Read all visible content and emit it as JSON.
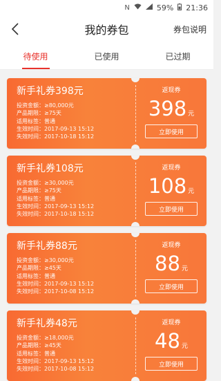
{
  "status_bar": {
    "battery": "59%",
    "time": "21:36"
  },
  "nav": {
    "title": "我的券包",
    "right_label": "券包说明"
  },
  "tabs": [
    {
      "label": "待使用",
      "active": true
    },
    {
      "label": "已使用",
      "active": false
    },
    {
      "label": "已过期",
      "active": false
    }
  ],
  "row_labels": {
    "amount": "投资金额：",
    "period": "产品期限：",
    "tag": "适用标签：",
    "start": "生效时间：",
    "end": "失效时间："
  },
  "coupons": [
    {
      "title": "新手礼券398元",
      "amount_req": "≥80,000元",
      "period": "≥75天",
      "tag": "普通",
      "start": "2017-09-13 15:12",
      "end": "2017-10-18 15:12",
      "type": "返现券",
      "amount": "398",
      "unit": "元",
      "button": "立即使用"
    },
    {
      "title": "新手礼券108元",
      "amount_req": "≥30,000元",
      "period": "≥75天",
      "tag": "普通",
      "start": "2017-09-13 15:12",
      "end": "2017-10-18 15:12",
      "type": "返现券",
      "amount": "108",
      "unit": "元",
      "button": "立即使用"
    },
    {
      "title": "新手礼券88元",
      "amount_req": "≥30,000元",
      "period": "≥45天",
      "tag": "普通",
      "start": "2017-09-13 15:12",
      "end": "2017-10-08 15:12",
      "type": "返现券",
      "amount": "88",
      "unit": "元",
      "button": "立即使用"
    },
    {
      "title": "新手礼券48元",
      "amount_req": "≥18,000元",
      "period": "≥45天",
      "tag": "普通",
      "start": "2017-09-13 15:12",
      "end": "2017-10-08 15:12",
      "type": "返现券",
      "amount": "48",
      "unit": "元",
      "button": "立即使用"
    }
  ],
  "colors": {
    "accent": "#e8322b",
    "coupon_bg": "#f8773a"
  }
}
